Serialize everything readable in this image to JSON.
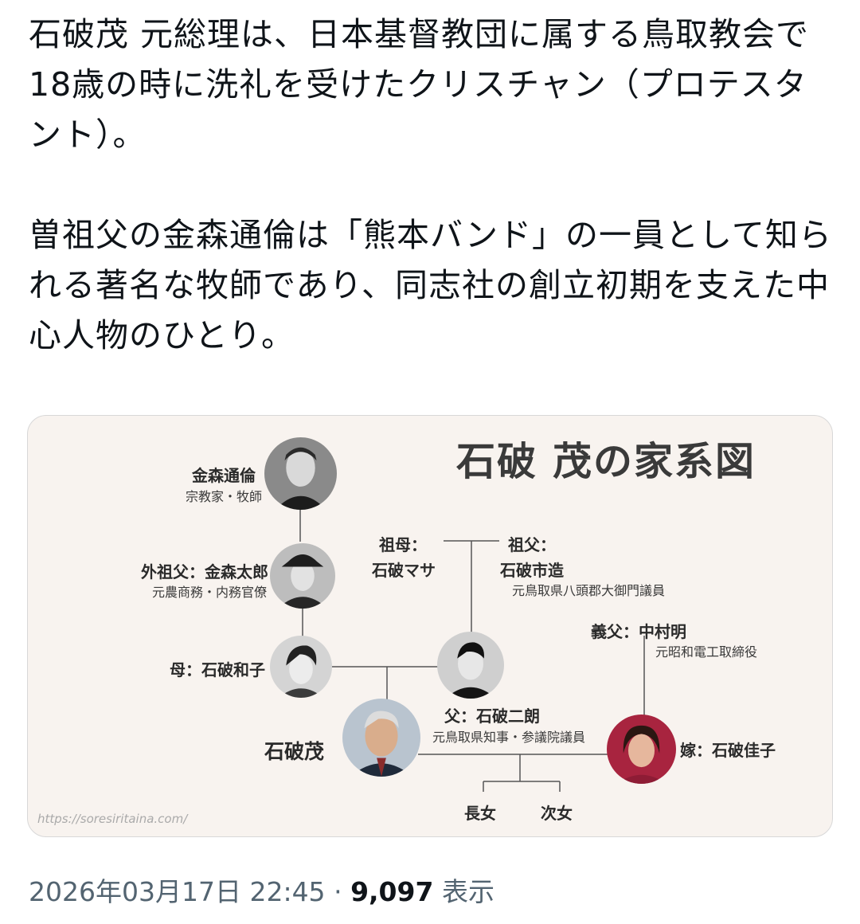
{
  "tweet": {
    "paragraph1": "石破茂 元総理は、日本基督教団に属する鳥取教会で18歳の時に洗礼を受けたクリスチャン（プロテスタント）。",
    "paragraph2": "曽祖父の金森通倫は「熊本バンド」の一員として知られる著名な牧師であり、同志社の創立初期を支えた中心人物のひとり。"
  },
  "family_tree": {
    "title": "石破 茂の家系図",
    "source_url": "https://soresiritaina.com/",
    "people": {
      "kanamori_michitomo": {
        "name": "金森通倫",
        "role": "宗教家・牧師"
      },
      "kanamori_taro": {
        "name": "外祖父：金森太郎",
        "role": "元農商務・内務官僚"
      },
      "mother": {
        "name": "母：石破和子"
      },
      "grandmother": {
        "label": "祖母：",
        "name": "石破マサ"
      },
      "grandfather": {
        "label": "祖父：",
        "name": "石破市造",
        "role": "元鳥取県八頭郡大御門議員"
      },
      "father": {
        "name": "父：石破二朗",
        "role": "元鳥取県知事・参議院議員"
      },
      "father_in_law": {
        "name": "義父：中村明",
        "role": "元昭和電工取締役"
      },
      "shigeru": {
        "name": "石破茂"
      },
      "wife": {
        "name": "嫁：石破佳子"
      },
      "daughter1": {
        "name": "長女"
      },
      "daughter2": {
        "name": "次女"
      }
    }
  },
  "meta": {
    "timestamp": "2026年03月17日 22:45",
    "separator": "·",
    "views_count": "9,097",
    "views_label": "表示"
  }
}
